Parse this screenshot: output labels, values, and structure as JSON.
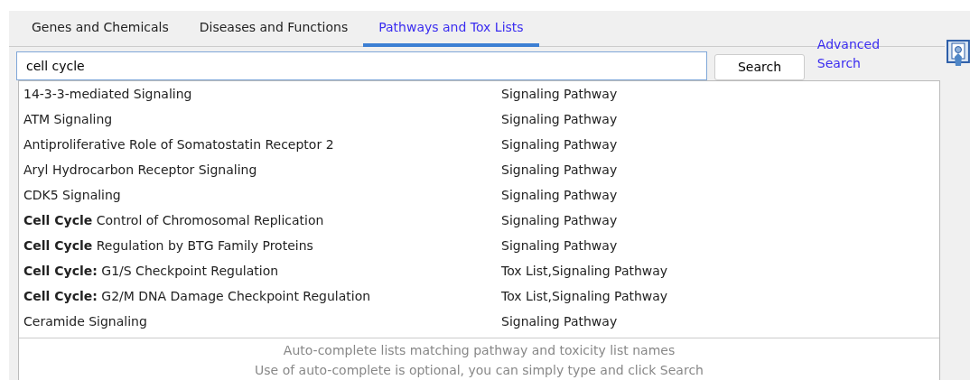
{
  "tabs": [
    {
      "label": "Genes and Chemicals",
      "selected": false
    },
    {
      "label": "Diseases and Functions",
      "selected": false
    },
    {
      "label": "Pathways and Tox Lists",
      "selected": true
    }
  ],
  "search": {
    "value": "cell cycle",
    "button": "Search",
    "advanced_link": "Advanced Search"
  },
  "suggestions": [
    {
      "name": "14-3-3-mediated Signaling",
      "type": "Signaling Pathway"
    },
    {
      "name": "ATM Signaling",
      "type": "Signaling Pathway"
    },
    {
      "name": "Antiproliferative Role of Somatostatin Receptor 2",
      "type": "Signaling Pathway"
    },
    {
      "name": "Aryl Hydrocarbon Receptor Signaling",
      "type": "Signaling Pathway"
    },
    {
      "name": "CDK5 Signaling",
      "type": "Signaling Pathway"
    },
    {
      "name": "**Cell Cycle** Control of Chromosomal Replication",
      "type": "Signaling Pathway"
    },
    {
      "name": "**Cell Cycle** Regulation by BTG Family Proteins",
      "type": "Signaling Pathway"
    },
    {
      "name": "**Cell Cycle:** G1/S Checkpoint Regulation",
      "type": "Tox List,Signaling Pathway"
    },
    {
      "name": "**Cell Cycle:** G2/M DNA Damage Checkpoint Regulation",
      "type": "Tox List,Signaling Pathway"
    },
    {
      "name": "Ceramide Signaling",
      "type": "Signaling Pathway"
    }
  ],
  "footer": [
    "Auto-complete lists matching pathway and toxicity list names",
    "Use of auto-complete is optional, you can simply type and click Search"
  ]
}
